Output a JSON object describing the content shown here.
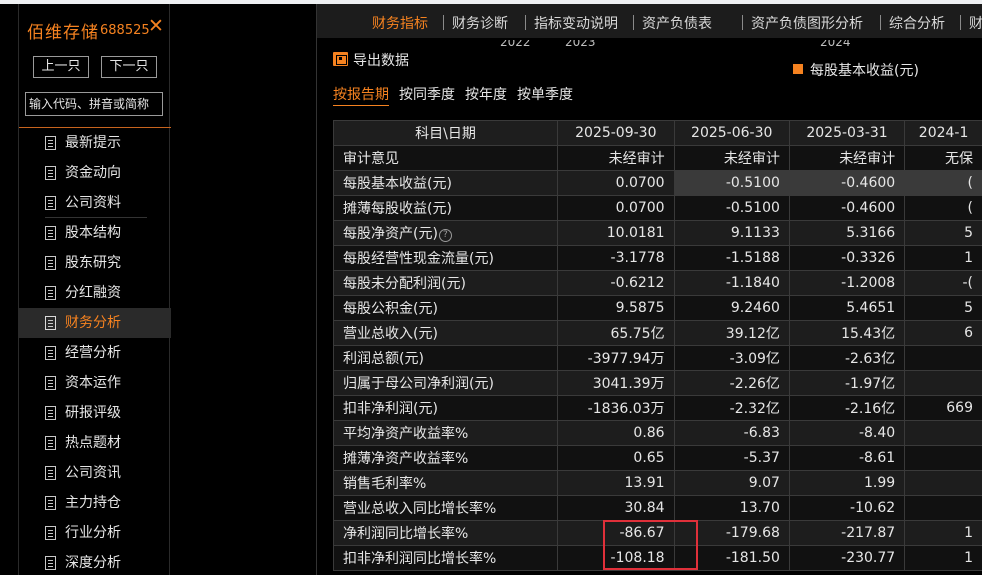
{
  "stock": {
    "name": "佰维存储",
    "code": "688525",
    "close": "✕"
  },
  "nav": {
    "prev": "上一只",
    "next": "下一只",
    "search_placeholder": "输入代码、拼音或简称"
  },
  "menu": [
    {
      "label": "最新提示",
      "active": false
    },
    {
      "label": "资金动向",
      "active": false
    },
    {
      "label": "公司资料",
      "active": false
    },
    {
      "label": "股本结构",
      "active": false
    },
    {
      "label": "股东研究",
      "active": false
    },
    {
      "label": "分红融资",
      "active": false
    },
    {
      "label": "财务分析",
      "active": true
    },
    {
      "label": "经营分析",
      "active": false
    },
    {
      "label": "资本运作",
      "active": false
    },
    {
      "label": "研报评级",
      "active": false
    },
    {
      "label": "热点题材",
      "active": false
    },
    {
      "label": "公司资讯",
      "active": false
    },
    {
      "label": "主力持仓",
      "active": false
    },
    {
      "label": "行业分析",
      "active": false
    },
    {
      "label": "深度分析",
      "active": false
    }
  ],
  "tabs": [
    {
      "label": "财务指标",
      "active": true
    },
    {
      "label": "财务诊断",
      "active": false
    },
    {
      "label": "指标变动说明",
      "active": false
    },
    {
      "label": "资产负债表",
      "active": false
    },
    {
      "label": "资产负债图形分析",
      "active": false
    },
    {
      "label": "综合分析",
      "active": false
    },
    {
      "label": "财",
      "active": false
    }
  ],
  "ghost_years": [
    "2022",
    "2023",
    "2024"
  ],
  "export_label": "导出数据",
  "legend": {
    "label": "每股基本收益(元)",
    "color": "#f58220"
  },
  "periods": [
    {
      "label": "按报告期",
      "active": true
    },
    {
      "label": "按同季度",
      "active": false
    },
    {
      "label": "按年度",
      "active": false
    },
    {
      "label": "按单季度",
      "active": false
    }
  ],
  "table": {
    "header": [
      "科目\\日期",
      "2025-09-30",
      "2025-06-30",
      "2025-03-31",
      "2024-1"
    ],
    "rows": [
      {
        "name": "审计意见",
        "values": [
          "未经审计",
          "未经审计",
          "未经审计",
          "无保"
        ]
      },
      {
        "name": "每股基本收益(元)",
        "values": [
          "0.0700",
          "-0.5100",
          "-0.4600",
          "("
        ]
      },
      {
        "name": "摊薄每股收益(元)",
        "values": [
          "0.0700",
          "-0.5100",
          "-0.4600",
          "("
        ]
      },
      {
        "name": "每股净资产(元)",
        "values": [
          "10.0181",
          "9.1133",
          "5.3166",
          "5"
        ],
        "help": "?"
      },
      {
        "name": "每股经营性现金流量(元)",
        "values": [
          "-3.1778",
          "-1.5188",
          "-0.3326",
          "1"
        ]
      },
      {
        "name": "每股未分配利润(元)",
        "values": [
          "-0.6212",
          "-1.1840",
          "-1.2008",
          "-("
        ]
      },
      {
        "name": "每股公积金(元)",
        "values": [
          "9.5875",
          "9.2460",
          "5.4651",
          "5"
        ]
      },
      {
        "name": "营业总收入(元)",
        "values": [
          "65.75亿",
          "39.12亿",
          "15.43亿",
          "6"
        ]
      },
      {
        "name": "利润总额(元)",
        "values": [
          "-3977.94万",
          "-3.09亿",
          "-2.63亿",
          ""
        ]
      },
      {
        "name": "归属于母公司净利润(元)",
        "values": [
          "3041.39万",
          "-2.26亿",
          "-1.97亿",
          ""
        ]
      },
      {
        "name": "扣非净利润(元)",
        "values": [
          "-1836.03万",
          "-2.32亿",
          "-2.16亿",
          "669"
        ]
      },
      {
        "name": "平均净资产收益率%",
        "values": [
          "0.86",
          "-6.83",
          "-8.40",
          ""
        ]
      },
      {
        "name": "摊薄净资产收益率%",
        "values": [
          "0.65",
          "-5.37",
          "-8.61",
          ""
        ]
      },
      {
        "name": "销售毛利率%",
        "values": [
          "13.91",
          "9.07",
          "1.99",
          ""
        ]
      },
      {
        "name": "营业总收入同比增长率%",
        "values": [
          "30.84",
          "13.70",
          "-10.62",
          ""
        ]
      },
      {
        "name": "净利润同比增长率%",
        "values": [
          "-86.67",
          "-179.68",
          "-217.87",
          "1"
        ]
      },
      {
        "name": "扣非净利润同比增长率%",
        "values": [
          "-108.18",
          "-181.50",
          "-230.77",
          "1"
        ]
      }
    ]
  },
  "colors": {
    "accent": "#f58220",
    "highlight_box": "#e0303a",
    "selected_row": "#3a3a3a"
  }
}
